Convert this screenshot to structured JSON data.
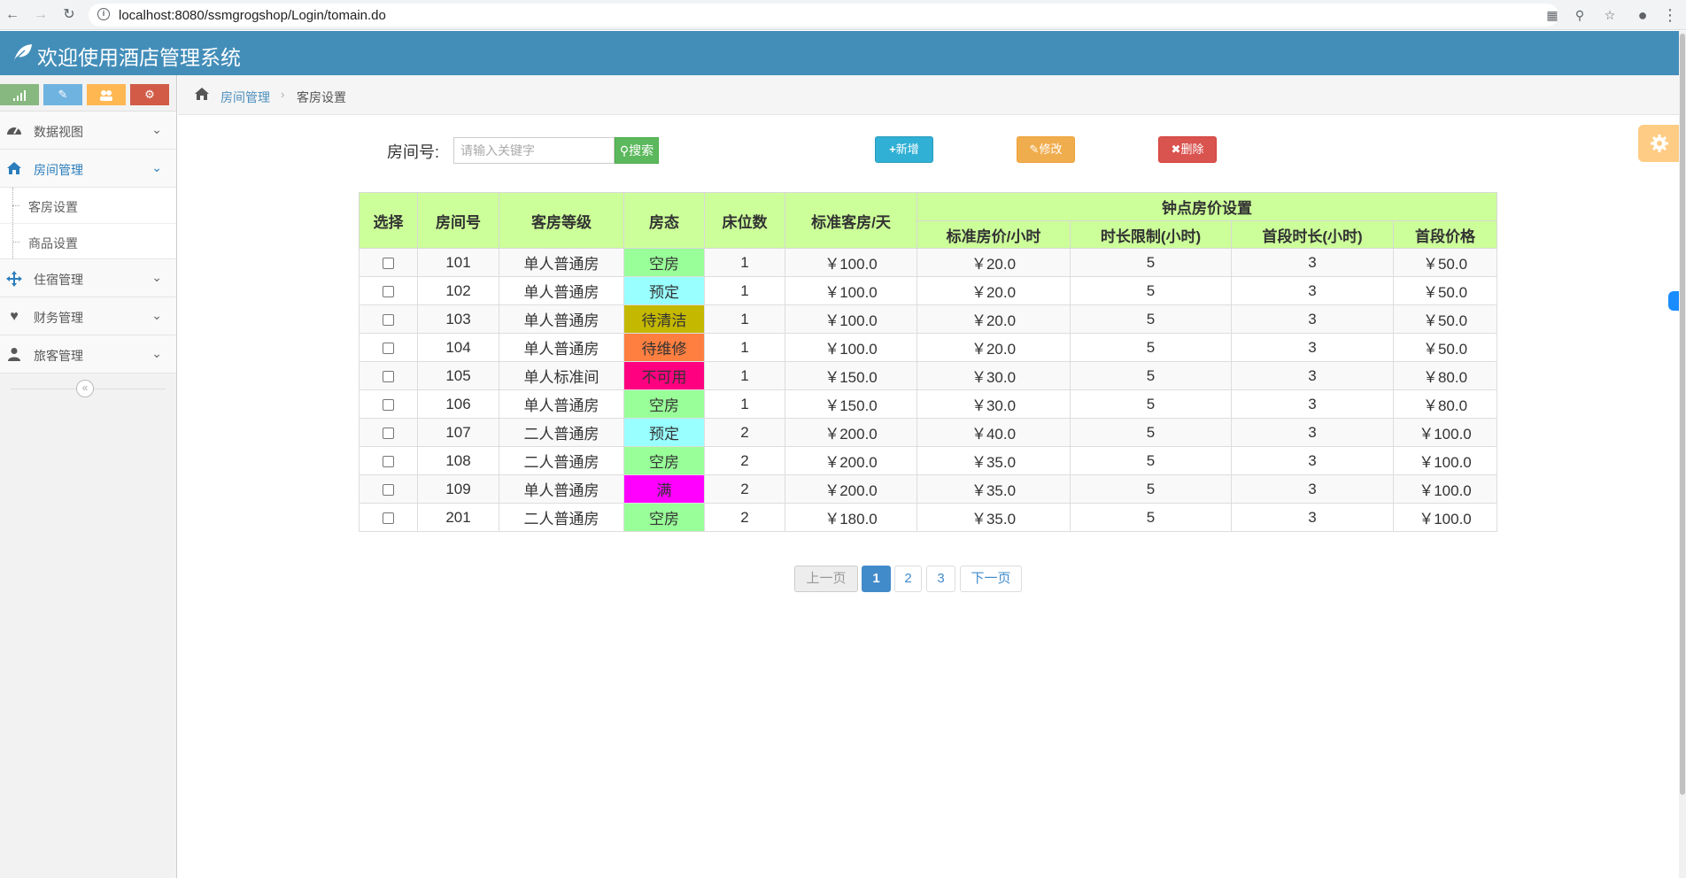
{
  "browser": {
    "url": "localhost:8080/ssmgrogshop/Login/tomain.do"
  },
  "app": {
    "title": "欢迎使用酒店管理系统"
  },
  "colors": {
    "header": "#438eb9",
    "table_header": "#ccff99",
    "status_empty": "#99ff99",
    "status_reserved": "#99ffff",
    "status_cleaning": "#c4b800",
    "status_repair": "#ff7f40",
    "status_unavailable": "#ff0080",
    "status_full": "#ff00ff"
  },
  "sidebar": {
    "shortcuts": [
      {
        "icon": "signal-icon",
        "color": "#87b87f"
      },
      {
        "icon": "pencil-icon",
        "color": "#6fb3e0"
      },
      {
        "icon": "users-icon",
        "color": "#ffb752"
      },
      {
        "icon": "cogs-icon",
        "color": "#d15b47"
      }
    ],
    "menu": [
      {
        "label": "数据视图",
        "icon": "dashboard-icon"
      },
      {
        "label": "房间管理",
        "icon": "home-icon",
        "active": true
      },
      {
        "label": "住宿管理",
        "icon": "move-icon"
      },
      {
        "label": "财务管理",
        "icon": "heart-icon"
      },
      {
        "label": "旅客管理",
        "icon": "user-icon"
      }
    ],
    "submenu": [
      "客房设置",
      "商品设置"
    ]
  },
  "breadcrumb": {
    "parent": "房间管理",
    "current": "客房设置"
  },
  "search": {
    "label": "房间号:",
    "placeholder": "请输入关键字",
    "button": "搜索"
  },
  "actions": {
    "add": "新增",
    "edit": "修改",
    "delete": "删除"
  },
  "table": {
    "group_header": "钟点房价设置",
    "columns": [
      "选择",
      "房间号",
      "客房等级",
      "房态",
      "床位数",
      "标准客房/天",
      "标准房价/小时",
      "时长限制(小时)",
      "首段时长(小时)",
      "首段价格"
    ],
    "rows": [
      {
        "room": "101",
        "level": "单人普通房",
        "status": "空房",
        "status_color": "#99ff99",
        "beds": "1",
        "day_price": "￥100.0",
        "hour_price": "￥20.0",
        "limit": "5",
        "first_hours": "3",
        "first_price": "￥50.0"
      },
      {
        "room": "102",
        "level": "单人普通房",
        "status": "预定",
        "status_color": "#99ffff",
        "beds": "1",
        "day_price": "￥100.0",
        "hour_price": "￥20.0",
        "limit": "5",
        "first_hours": "3",
        "first_price": "￥50.0"
      },
      {
        "room": "103",
        "level": "单人普通房",
        "status": "待清洁",
        "status_color": "#c4b800",
        "beds": "1",
        "day_price": "￥100.0",
        "hour_price": "￥20.0",
        "limit": "5",
        "first_hours": "3",
        "first_price": "￥50.0"
      },
      {
        "room": "104",
        "level": "单人普通房",
        "status": "待维修",
        "status_color": "#ff7f40",
        "beds": "1",
        "day_price": "￥100.0",
        "hour_price": "￥20.0",
        "limit": "5",
        "first_hours": "3",
        "first_price": "￥50.0"
      },
      {
        "room": "105",
        "level": "单人标准间",
        "status": "不可用",
        "status_color": "#ff0080",
        "beds": "1",
        "day_price": "￥150.0",
        "hour_price": "￥30.0",
        "limit": "5",
        "first_hours": "3",
        "first_price": "￥80.0"
      },
      {
        "room": "106",
        "level": "单人普通房",
        "status": "空房",
        "status_color": "#99ff99",
        "beds": "1",
        "day_price": "￥150.0",
        "hour_price": "￥30.0",
        "limit": "5",
        "first_hours": "3",
        "first_price": "￥80.0"
      },
      {
        "room": "107",
        "level": "二人普通房",
        "status": "预定",
        "status_color": "#99ffff",
        "beds": "2",
        "day_price": "￥200.0",
        "hour_price": "￥40.0",
        "limit": "5",
        "first_hours": "3",
        "first_price": "￥100.0"
      },
      {
        "room": "108",
        "level": "二人普通房",
        "status": "空房",
        "status_color": "#99ff99",
        "beds": "2",
        "day_price": "￥200.0",
        "hour_price": "￥35.0",
        "limit": "5",
        "first_hours": "3",
        "first_price": "￥100.0"
      },
      {
        "room": "109",
        "level": "单人普通房",
        "status": "满",
        "status_color": "#ff00ff",
        "beds": "2",
        "day_price": "￥200.0",
        "hour_price": "￥35.0",
        "limit": "5",
        "first_hours": "3",
        "first_price": "￥100.0"
      },
      {
        "room": "201",
        "level": "二人普通房",
        "status": "空房",
        "status_color": "#99ff99",
        "beds": "2",
        "day_price": "￥180.0",
        "hour_price": "￥35.0",
        "limit": "5",
        "first_hours": "3",
        "first_price": "￥100.0"
      }
    ]
  },
  "pagination": {
    "prev": "上一页",
    "pages": [
      "1",
      "2",
      "3"
    ],
    "current": "1",
    "next": "下一页"
  }
}
